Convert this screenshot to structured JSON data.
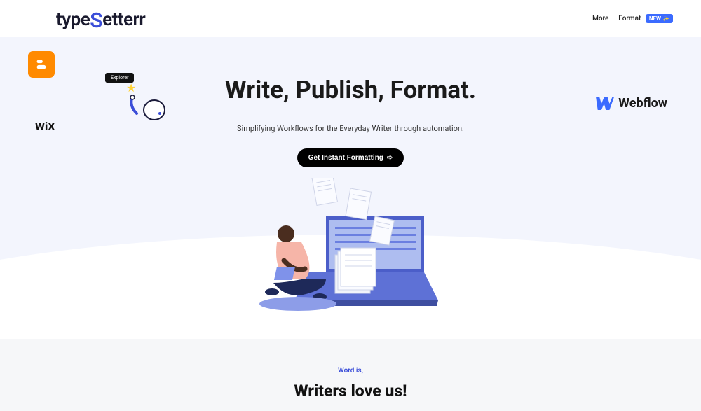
{
  "header": {
    "logo_prefix": "type",
    "logo_s": "S",
    "logo_suffix": "etterr",
    "nav": {
      "more": "More",
      "format": "Format",
      "badge": "NEW ✨"
    }
  },
  "hero": {
    "title": "Write, Publish, Format.",
    "subtitle": "Simplifying Workflows for the Everyday Writer through automation.",
    "cta": "Get Instant Formatting",
    "explorer_badge": "Explorer"
  },
  "brands": {
    "wix": "WiX",
    "webflow": "Webflow"
  },
  "below": {
    "eyebrow": "Word is,",
    "heading": "Writers love us!"
  }
}
